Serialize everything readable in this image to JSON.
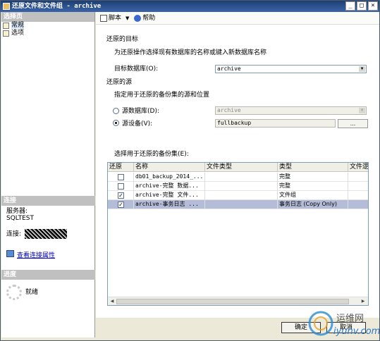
{
  "window": {
    "title": "还原文件和文件组 - archive",
    "minimize": "_",
    "maximize": "□",
    "close": "×"
  },
  "left": {
    "select_page_header": "选择页",
    "pages": [
      {
        "label": "常规"
      },
      {
        "label": "选项"
      }
    ],
    "connection_header": "连接",
    "server_label": "服务器:",
    "server_value": "SQLTEST",
    "connection_label": "连接:",
    "view_connection_link": "查看连接属性",
    "progress_header": "进度",
    "progress_status": "就绪"
  },
  "toolbar": {
    "script_label": "脚本",
    "help_label": "帮助"
  },
  "form": {
    "target_section": "还原的目标",
    "target_desc": "为还原操作选择现有数据库的名称或键入新数据库名称",
    "target_db_label": "目标数据库(O):",
    "target_db_value": "archive",
    "source_section": "还原的源",
    "source_desc": "指定用于还原的备份集的源和位置",
    "source_db_label": "源数据库(D):",
    "source_db_value": "archive",
    "source_device_label": "源设备(V):",
    "source_device_value": "fullbackup",
    "browse_label": "...",
    "backup_sets_label": "选择用于还原的备份集(E):"
  },
  "grid": {
    "columns": [
      "还原",
      "名称",
      "文件类型",
      "类型",
      "文件逻"
    ],
    "rows": [
      {
        "restore": false,
        "name": "db01_backup_2014_...",
        "file_type": "",
        "type": "完整"
      },
      {
        "restore": false,
        "name": "archive-完整 数据...",
        "file_type": "",
        "type": "完整"
      },
      {
        "restore": true,
        "name": "archive-完整 文件...",
        "file_type": "",
        "type": "文件组"
      },
      {
        "restore": true,
        "name": "archive-事务日志 ...",
        "file_type": "",
        "type": "事务日志 (Copy Only)",
        "selected": true
      }
    ]
  },
  "buttons": {
    "ok": "确定",
    "cancel": "取消"
  },
  "watermark": {
    "cn": "运维网",
    "en": "iyunv.com"
  }
}
